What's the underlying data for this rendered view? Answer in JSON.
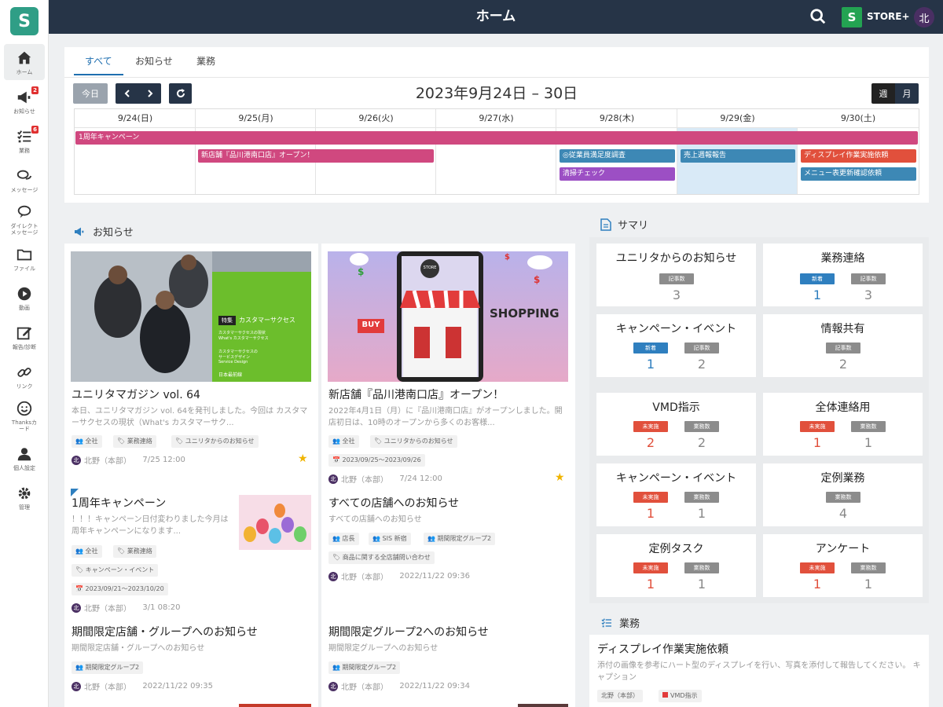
{
  "app": {
    "title": "ホーム",
    "store_label": "STORE+",
    "logo": "S",
    "store_badge": "S",
    "avatar": "北"
  },
  "colors": {
    "nav_bg": "#263447",
    "accent": "#1f6fb0",
    "pink": "#d0487f",
    "purple": "#9c4fc4",
    "blue": "#3d88b5",
    "red": "#e1503c",
    "gray": "#8c8c8c"
  },
  "sidebar": {
    "items": [
      {
        "label": "ホーム",
        "icon": "home-icon",
        "active": true
      },
      {
        "label": "お知らせ",
        "icon": "megaphone-icon",
        "badge": "2"
      },
      {
        "label": "業務",
        "icon": "checklist-icon",
        "badge": "6"
      },
      {
        "label": "メッセージ",
        "icon": "chat-icon"
      },
      {
        "label": "ダイレクト\nメッセージ",
        "icon": "direct-message-icon"
      },
      {
        "label": "ファイル",
        "icon": "folder-icon"
      },
      {
        "label": "動画",
        "icon": "play-icon"
      },
      {
        "label": "報告/診断",
        "icon": "edit-icon"
      },
      {
        "label": "リンク",
        "icon": "link-icon"
      },
      {
        "label": "Thanksカ\nード",
        "icon": "smile-icon"
      },
      {
        "label": "個人設定",
        "icon": "person-icon"
      },
      {
        "label": "管理",
        "icon": "gear-icon"
      }
    ]
  },
  "calendar": {
    "tabs": [
      "すべて",
      "お知らせ",
      "業務"
    ],
    "today_label": "今日",
    "range": "2023年9月24日 – 30日",
    "view_week": "週",
    "view_month": "月",
    "days": [
      "9/24(日)",
      "9/25(月)",
      "9/26(火)",
      "9/27(水)",
      "9/28(木)",
      "9/29(金)",
      "9/30(土)"
    ],
    "events": [
      {
        "label": "1周年キャンペーン",
        "color": "#d0487f"
      },
      {
        "label": "新店舗『品川港南口店』オープン！",
        "color": "#d0487f"
      },
      {
        "label": "◎従業員満足度調査",
        "color": "#3d88b5"
      },
      {
        "label": "清掃チェック",
        "color": "#9c4fc4"
      },
      {
        "label": "売上週報報告",
        "color": "#3d88b5"
      },
      {
        "label": "ディスプレイ作業実施依頼",
        "color": "#e1503c"
      },
      {
        "label": "メニュー表更新確認依頼",
        "color": "#3d88b5"
      }
    ]
  },
  "news": {
    "heading": "お知らせ",
    "cards": [
      {
        "title": "ユニリタマガジン vol. 64",
        "text": "本日、ユニリタマガジン vol. 64を発刊しました。今回は カスタマーサクセスの現状（What's カスタマーサク...",
        "tags": [
          "全社",
          "業務連絡",
          "ユニリタからのお知らせ"
        ],
        "author": "北野（本部）",
        "time": "7/25 12:00",
        "img_title": "カスタマーサクセス",
        "img_badge": "特集",
        "img_sub1": "カスタマーサクセスの現状",
        "img_sub2": "What's カスタマーサクセス",
        "img_sub3": "カスタマーサクセスの",
        "img_sub4": "サービスデザイン",
        "img_sub5": "Service Design",
        "img_sub6": "日本最前線"
      },
      {
        "title": "新店舗『品川港南口店』オープン！",
        "text": "2022年4月1日（月）に『品川港南口店』がオープンしました。開店初日は、10時のオープンから多くのお客様...",
        "tags": [
          "全社",
          "ユニリタからのお知らせ"
        ],
        "period": "2023/09/25～2023/09/26",
        "author": "北野（本部）",
        "time": "7/24 12:00",
        "img_shopping": "SHOPPING",
        "img_buy": "BUY",
        "img_store": "STORE"
      },
      {
        "title": "1周年キャンペーン",
        "text": "！！！キャンペーン日付変わりました今月は周年キャンペーンになります...",
        "tags": [
          "全社",
          "業務連絡",
          "キャンペーン・イベント"
        ],
        "period": "2023/09/21～2023/10/20",
        "author": "北野（本部）",
        "time": "3/1 08:20"
      },
      {
        "title": "すべての店舗へのお知らせ",
        "text": "すべての店舗へのお知らせ",
        "tags": [
          "店長",
          "SIS 新宿",
          "期間限定グループ2",
          "商品に関する全店舗問い合わせ"
        ],
        "author": "北野（本部）",
        "time": "2022/11/22 09:36"
      },
      {
        "title": "期間限定店舗・グループへのお知らせ",
        "text": "期間限定店舗・グループへのお知らせ",
        "tags": [
          "期間限定グループ2"
        ],
        "author": "北野（本部）",
        "time": "2022/11/22 09:35"
      },
      {
        "title": "期間限定グループ2へのお知らせ",
        "text": "期間限定グループへのお知らせ",
        "tags": [
          "期間限定グループ2"
        ],
        "author": "北野（本部）",
        "time": "2022/11/22 09:34"
      }
    ]
  },
  "summary": {
    "heading": "サマリ",
    "boxes": [
      {
        "title": "ユニリタからのお知らせ",
        "pills": [
          {
            "label": "記事数",
            "value": "3",
            "color": "#8c8c8c"
          }
        ]
      },
      {
        "title": "業務連絡",
        "pills": [
          {
            "label": "新着",
            "value": "1",
            "color": "#2f7fbf"
          },
          {
            "label": "記事数",
            "value": "3",
            "color": "#8c8c8c"
          }
        ]
      },
      {
        "title": "キャンペーン・イベント",
        "pills": [
          {
            "label": "新着",
            "value": "1",
            "color": "#2f7fbf"
          },
          {
            "label": "記事数",
            "value": "2",
            "color": "#8c8c8c"
          }
        ]
      },
      {
        "title": "情報共有",
        "pills": [
          {
            "label": "記事数",
            "value": "2",
            "color": "#8c8c8c"
          }
        ]
      },
      {
        "title": "VMD指示",
        "pills": [
          {
            "label": "未実施",
            "value": "2",
            "color": "#e1503c"
          },
          {
            "label": "業務数",
            "value": "2",
            "color": "#8c8c8c"
          }
        ]
      },
      {
        "title": "全体連絡用",
        "pills": [
          {
            "label": "未実施",
            "value": "1",
            "color": "#e1503c"
          },
          {
            "label": "業務数",
            "value": "1",
            "color": "#8c8c8c"
          }
        ]
      },
      {
        "title": "キャンペーン・イベント",
        "pills": [
          {
            "label": "未実施",
            "value": "1",
            "color": "#e1503c"
          },
          {
            "label": "業務数",
            "value": "1",
            "color": "#8c8c8c"
          }
        ]
      },
      {
        "title": "定例業務",
        "pills": [
          {
            "label": "業務数",
            "value": "4",
            "color": "#8c8c8c"
          }
        ]
      },
      {
        "title": "定例タスク",
        "pills": [
          {
            "label": "未実施",
            "value": "1",
            "color": "#e1503c"
          },
          {
            "label": "業務数",
            "value": "1",
            "color": "#8c8c8c"
          }
        ]
      },
      {
        "title": "アンケート",
        "pills": [
          {
            "label": "未実施",
            "value": "1",
            "color": "#e1503c"
          },
          {
            "label": "業務数",
            "value": "1",
            "color": "#8c8c8c"
          }
        ]
      }
    ]
  },
  "tasks": {
    "heading": "業務",
    "item": {
      "title": "ディスプレイ作業実施依頼",
      "text": "添付の画像を参考にハート型のディスプレイを行い、写真を添付して報告してください。 キャプション",
      "author": "北野（本部）",
      "tag": "VMD指示"
    }
  }
}
